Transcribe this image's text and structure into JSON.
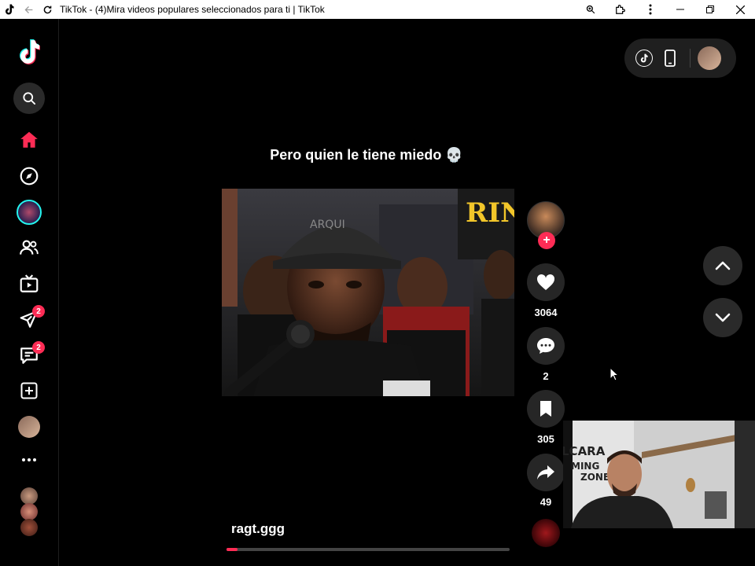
{
  "window": {
    "title": "TikTok - (4)Mira videos populares seleccionados para ti | TikTok"
  },
  "sidebar": {
    "messages_badge": "2",
    "inbox_badge": "2"
  },
  "video": {
    "caption": "Pero quien le tiene miedo 💀",
    "username": "ragt.ggg",
    "progress": 0.04,
    "overlay_logo_text": "RIN",
    "cap_text": "ARQUI"
  },
  "actions": {
    "likes": "3064",
    "comments": "2",
    "saves": "305",
    "shares": "49"
  },
  "webcam": {
    "wall_text_1": "LCARA",
    "wall_text_2": "MING",
    "wall_text_3": "ZONE"
  },
  "colors": {
    "accent": "#fe2c55",
    "background": "#000000"
  }
}
